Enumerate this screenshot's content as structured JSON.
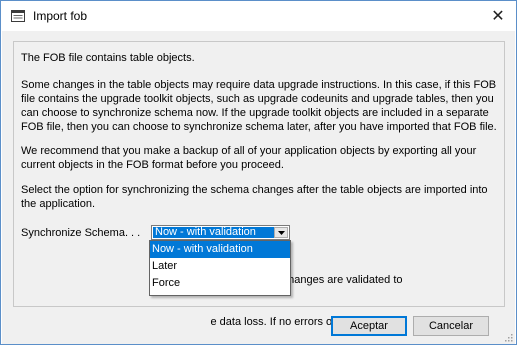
{
  "window": {
    "title": "Import fob",
    "icon": "dialog-window-icon",
    "close_glyph": "✕"
  },
  "body": {
    "paragraph1": "The FOB file contains table objects.",
    "paragraph2_lines": [
      "Some changes in the table objects may require data upgrade instructions. In this case, if this FOB",
      "file contains the upgrade toolkit objects, such as upgrade codeunits and upgrade tables, then you",
      "can choose to synchronize schema now. If the upgrade toolkit objects are included in a separate",
      "FOB file, then you can choose to synchronize schema later, after you have imported that FOB file."
    ],
    "paragraph3_lines": [
      "We recommend that you make a backup of all of your application objects by exporting all your",
      "current objects in the FOB format before you proceed."
    ],
    "paragraph4_lines": [
      "Select the option for synchronizing the schema changes after the table objects are imported into",
      "the application."
    ],
    "sync_label": "Synchronize Schema. . .",
    "sync_value": "Now - with validation",
    "description_visible_lines": [
      "                                                              atabase table, changes are validated to",
      "                                                              e data loss. If no errors occur, then they"
    ],
    "sync_options": [
      "Now - with validation",
      "Later",
      "Force"
    ],
    "selected_option_index": 0
  },
  "buttons": {
    "ok_label": "Aceptar",
    "cancel_label": "Cancelar"
  },
  "colors": {
    "selection": "#0078d7",
    "window_border": "#5b8fc9",
    "dialog_background": "#f0f0f0"
  }
}
